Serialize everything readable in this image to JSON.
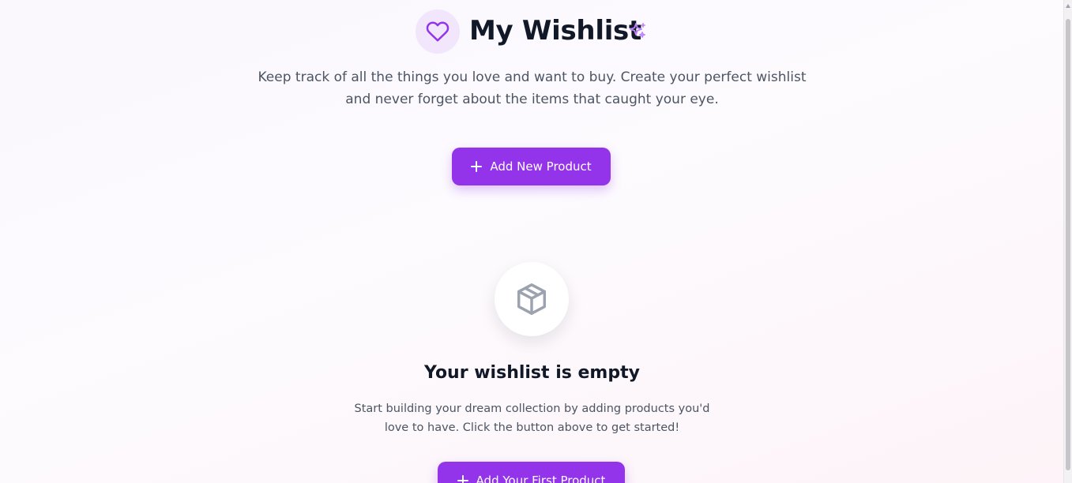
{
  "header": {
    "title": "My Wishlist",
    "icon": "heart-icon",
    "decoration_icon": "sparkles-icon",
    "subtitle_line1": "Keep track of all the things you love and want to buy. Create your perfect wishlist",
    "subtitle_line2": "and never forget about the items that caught your eye."
  },
  "actions": {
    "add_label": "Add New Product",
    "add_icon": "plus-icon"
  },
  "empty_state": {
    "icon": "package-icon",
    "title": "Your wishlist is empty",
    "text_line1": "Start building your dream collection by adding products you'd",
    "text_line2": "love to have. Click the button above to get started!",
    "button_label": "Add Your First Product"
  },
  "colors": {
    "accent": "#9333ea",
    "accent_soft": "#f1e6fb",
    "heading": "#111827",
    "body_text": "#4b5563"
  }
}
